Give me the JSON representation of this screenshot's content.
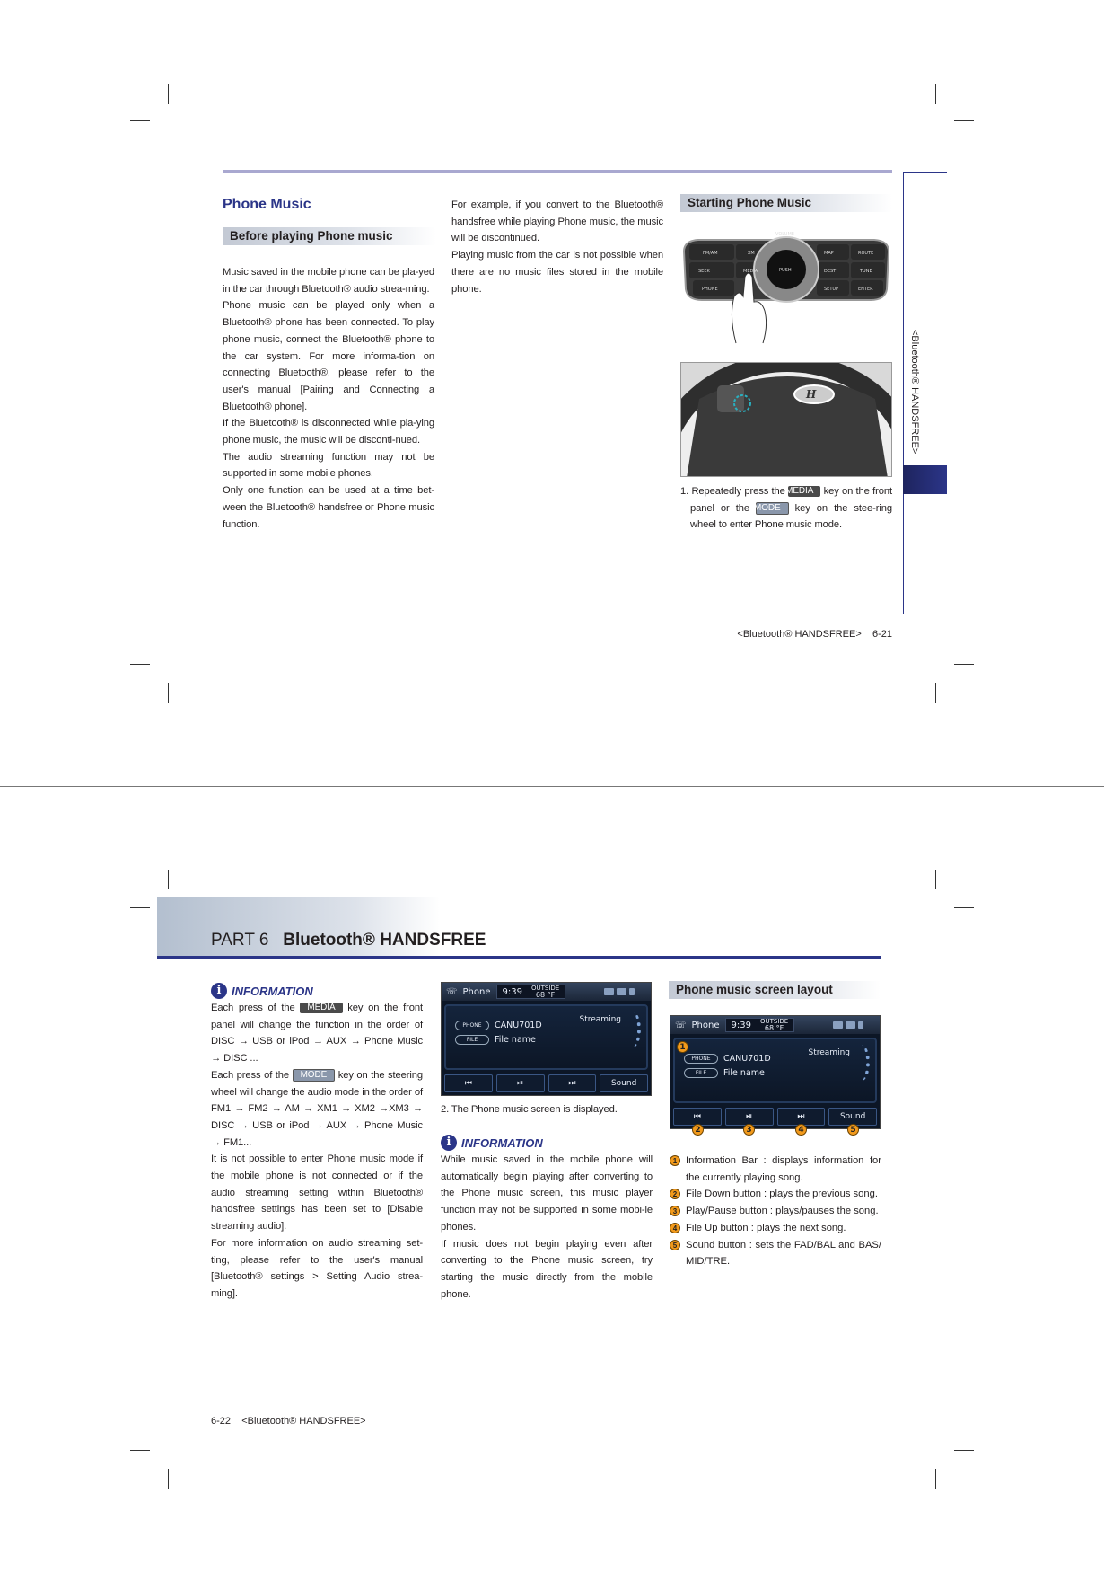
{
  "page1": {
    "title": "Phone Music",
    "section1": "Before playing Phone music",
    "col1": [
      "Music saved in the mobile phone can be pla-yed in the car through Bluetooth® audio strea-ming.",
      "Phone music can be played only when a Bluetooth® phone has been connected. To play phone music, connect the Bluetooth® phone to the car system. For more informa-tion on connecting Bluetooth®, please refer to the user's manual [Pairing and Connecting a Bluetooth® phone].",
      "If the Bluetooth® is disconnected while pla-ying phone music, the music will be disconti-nued.",
      "The audio streaming function may not be supported in some mobile phones.",
      "Only one function can be used at a time bet-ween the Bluetooth® handsfree or Phone music function."
    ],
    "col2": [
      "For example, if you convert to the Bluetooth® handsfree while playing Phone music, the music will be discontinued.",
      "Playing music from the car is not possible when there are no music files stored in the mobile phone."
    ],
    "section2": "Starting Phone Music",
    "panel_keys": {
      "volume": "VOLUME",
      "fmam": "FM/AM",
      "xm": "XM",
      "map": "MAP VOICE",
      "route": "ROUTE",
      "seek": "SEEK TRACK",
      "media": "MEDIA",
      "power": "PUSH POWER",
      "dest": "DEST",
      "tune": "TUNE",
      "phone": "PHONE",
      "setup": "SETUP",
      "enter": "ENTER"
    },
    "step1": {
      "a": "1. Repeatedly press the ",
      "key1": "MEDIA",
      "b": " key on the front panel or the ",
      "key2": "MODE",
      "c": " key on the stee-ring wheel to enter Phone music mode."
    },
    "side_tab": "<Bluetooth® HANDSFREE>",
    "footer": "<Bluetooth® HANDSFREE>    6-21"
  },
  "page2": {
    "header_part": "PART 6",
    "header_title": "Bluetooth® HANDSFREE",
    "info_label": "INFORMATION",
    "info1": {
      "p1a": "Each press of the ",
      "key1": "MEDIA",
      "p1b": " key on the front panel will change the function in the order of DISC → USB or iPod → AUX → Phone Music → DISC ...",
      "p2a": "Each press of the ",
      "key2": "MODE",
      "p2b": " key on the steering wheel will change the audio mode in the order of FM1 → FM2 → AM → XM1 → XM2 →XM3 → DISC → USB or iPod → AUX → Phone Music → FM1...",
      "p3": "It is not possible to enter Phone music mode if the mobile phone is not connected or if the audio streaming setting within Bluetooth® handsfree settings has been set to [Disable streaming audio].",
      "p4": "For more information on audio streaming set-ting, please refer to the user's manual [Bluetooth® settings > Setting Audio strea-ming]."
    },
    "screen": {
      "title": "Phone",
      "time": "9:39",
      "outside_label": "OUTSIDE",
      "temp": "68 °F",
      "streaming": "Streaming",
      "phone_tag": "PHONE",
      "phone_value": "CANU701D",
      "file_tag": "FILE",
      "file_value": "File name",
      "btn_prev": "⏮",
      "btn_play": "⏯",
      "btn_next": "⏭",
      "btn_sound": "Sound"
    },
    "caption2": "2. The Phone music screen is displayed.",
    "info2": [
      "While music saved in the mobile phone will automatically begin playing after converting to the Phone music screen, this music player function may not be supported in some mobi-le phones.",
      "If music does not begin playing even after converting to the Phone music screen, try starting the music directly from the mobile phone."
    ],
    "section3": "Phone music screen layout",
    "callouts": [
      "1",
      "2",
      "3",
      "4",
      "5"
    ],
    "legend": [
      "Information Bar : displays information for the currently playing song.",
      "File Down button : plays the previous song.",
      "Play/Pause button : plays/pauses the song.",
      "File Up button : plays the next song.",
      "Sound button : sets the FAD/BAL and BAS/ MID/TRE."
    ],
    "footer": "6-22    <Bluetooth® HANDSFREE>"
  },
  "colors": {
    "accent": "#2b3588",
    "rule_top": "#a9a8d0",
    "callout": "#f29a1c"
  }
}
